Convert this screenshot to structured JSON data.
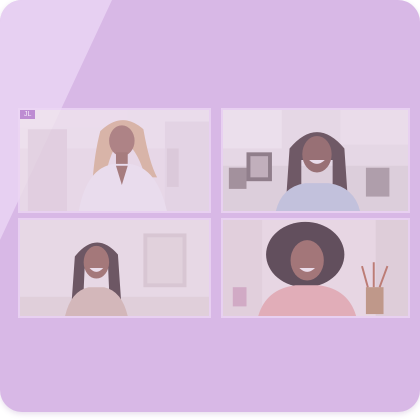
{
  "window": {
    "accent_color": "#d8b8e6",
    "tile_border_color": "#ecd6f4"
  },
  "call": {
    "participants": [
      {
        "name_tag": "JL",
        "video": "participant-video-1"
      },
      {
        "name_tag": "",
        "video": "participant-video-2"
      },
      {
        "name_tag": "",
        "video": "participant-video-3"
      },
      {
        "name_tag": "",
        "video": "participant-video-4"
      }
    ]
  }
}
